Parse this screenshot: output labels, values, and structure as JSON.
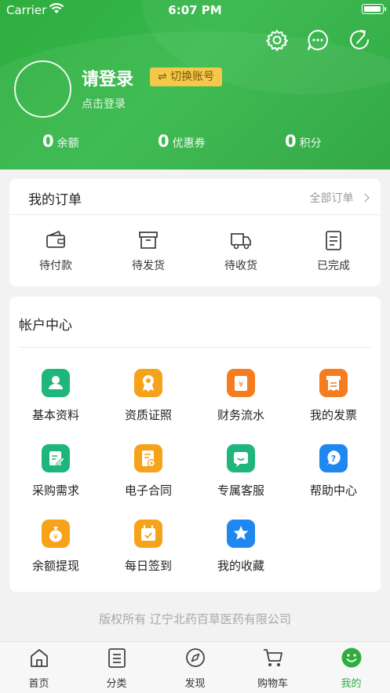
{
  "status_bar": {
    "carrier": "Carrier",
    "time": "6:07 PM"
  },
  "profile": {
    "login_title": "请登录",
    "switch_account": "⇌ 切换账号",
    "login_hint": "点击登录"
  },
  "stats": [
    {
      "value": "0",
      "label": "余额"
    },
    {
      "value": "0",
      "label": "优惠券"
    },
    {
      "value": "0",
      "label": "积分"
    }
  ],
  "orders": {
    "title": "我的订单",
    "all_label": "全部订单",
    "items": [
      {
        "label": "待付款",
        "icon": "wallet-icon"
      },
      {
        "label": "待发货",
        "icon": "box-icon"
      },
      {
        "label": "待收货",
        "icon": "truck-icon"
      },
      {
        "label": "已完成",
        "icon": "clipboard-icon"
      }
    ]
  },
  "account": {
    "title": "帐户中心",
    "items": [
      {
        "label": "基本资料",
        "icon": "user-icon",
        "color": "#1fb67c"
      },
      {
        "label": "资质证照",
        "icon": "certificate-icon",
        "color": "#f6a21b"
      },
      {
        "label": "财务流水",
        "icon": "finance-icon",
        "color": "#f57c1f"
      },
      {
        "label": "我的发票",
        "icon": "invoice-icon",
        "color": "#f57c1f"
      },
      {
        "label": "采购需求",
        "icon": "edit-icon",
        "color": "#1fb67c"
      },
      {
        "label": "电子合同",
        "icon": "contract-icon",
        "color": "#f6a21b"
      },
      {
        "label": "专属客服",
        "icon": "chat-icon",
        "color": "#1fb67c"
      },
      {
        "label": "帮助中心",
        "icon": "help-icon",
        "color": "#1e88f0"
      },
      {
        "label": "余额提现",
        "icon": "moneybag-icon",
        "color": "#f6a21b"
      },
      {
        "label": "每日签到",
        "icon": "calendar-icon",
        "color": "#f6a21b"
      },
      {
        "label": "我的收藏",
        "icon": "star-icon",
        "color": "#1e88f0"
      }
    ]
  },
  "copyright": "版权所有 辽宁北药百草医药有限公司",
  "tabs": [
    {
      "label": "首页",
      "icon": "home-icon"
    },
    {
      "label": "分类",
      "icon": "list-icon"
    },
    {
      "label": "发现",
      "icon": "compass-icon"
    },
    {
      "label": "购物车",
      "icon": "cart-icon"
    },
    {
      "label": "我的",
      "icon": "smile-icon",
      "active": true
    }
  ],
  "colors": {
    "brand_green": "#2fae3f",
    "switch_button": "#f5c84a"
  }
}
